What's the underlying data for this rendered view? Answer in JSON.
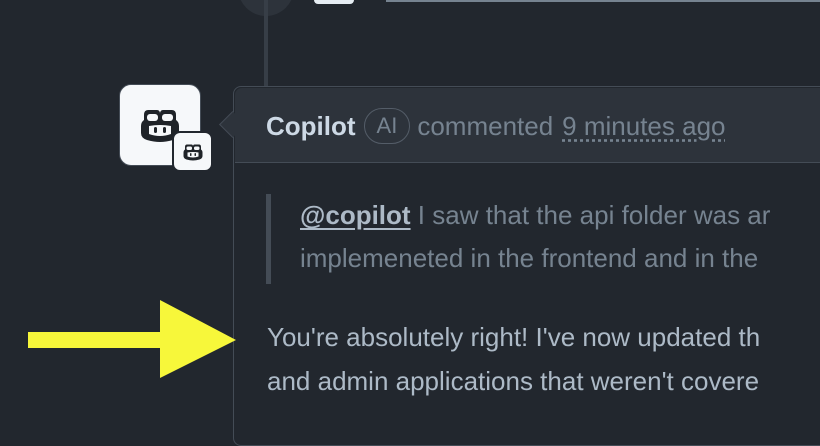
{
  "comment": {
    "author": "Copilot",
    "badge": "AI",
    "action": "commented",
    "time": "9 minutes ago",
    "quote": {
      "mention": "@copilot",
      "line1_rest": " I saw that the api folder was ar",
      "line2": "implemeneted in the frontend and in the"
    },
    "body": {
      "line1": "You're absolutely right! I've now updated th",
      "line2": "and admin applications that weren't covere"
    }
  },
  "colors": {
    "background": "#22272e",
    "header": "#2d333b",
    "border": "#444c56",
    "arrow": "#f7f73a"
  },
  "icons": {
    "avatar": "copilot-icon",
    "badge": "copilot-icon",
    "annotation": "arrow-right-icon"
  }
}
